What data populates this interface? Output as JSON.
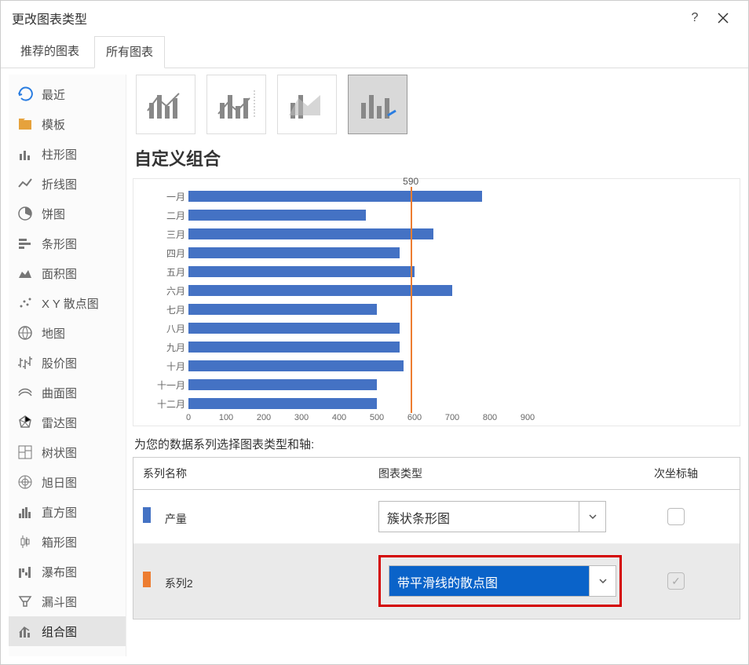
{
  "title": "更改图表类型",
  "tabs": {
    "recommended": "推荐的图表",
    "all": "所有图表"
  },
  "sidebar": {
    "items": [
      {
        "label": "最近",
        "icon": "recent"
      },
      {
        "label": "模板",
        "icon": "template"
      },
      {
        "label": "柱形图",
        "icon": "column"
      },
      {
        "label": "折线图",
        "icon": "line"
      },
      {
        "label": "饼图",
        "icon": "pie"
      },
      {
        "label": "条形图",
        "icon": "bar"
      },
      {
        "label": "面积图",
        "icon": "area"
      },
      {
        "label": "X Y 散点图",
        "icon": "scatter"
      },
      {
        "label": "地图",
        "icon": "map"
      },
      {
        "label": "股价图",
        "icon": "stock"
      },
      {
        "label": "曲面图",
        "icon": "surface"
      },
      {
        "label": "雷达图",
        "icon": "radar"
      },
      {
        "label": "树状图",
        "icon": "treemap"
      },
      {
        "label": "旭日图",
        "icon": "sunburst"
      },
      {
        "label": "直方图",
        "icon": "histogram"
      },
      {
        "label": "箱形图",
        "icon": "boxplot"
      },
      {
        "label": "瀑布图",
        "icon": "waterfall"
      },
      {
        "label": "漏斗图",
        "icon": "funnel"
      },
      {
        "label": "组合图",
        "icon": "combo"
      }
    ],
    "selected_index": 18
  },
  "thumbs": [
    "combo-1",
    "combo-2",
    "combo-3",
    "combo-4"
  ],
  "thumb_selected": 3,
  "section_title": "自定义组合",
  "series_caption": "为您的数据系列选择图表类型和轴:",
  "series_table": {
    "headers": {
      "name": "系列名称",
      "type": "图表类型",
      "secondary": "次坐标轴"
    },
    "rows": [
      {
        "swatch": "blue",
        "name": "产量",
        "type": "簇状条形图",
        "secondary": false,
        "selected": false,
        "secondary_enabled": true
      },
      {
        "swatch": "orange",
        "name": "系列2",
        "type": "带平滑线的散点图",
        "secondary": true,
        "selected": true,
        "secondary_enabled": false
      }
    ]
  },
  "chart_data": {
    "type": "bar",
    "categories": [
      "一月",
      "二月",
      "三月",
      "四月",
      "五月",
      "六月",
      "七月",
      "八月",
      "九月",
      "十月",
      "十一月",
      "十二月"
    ],
    "values": [
      780,
      470,
      650,
      560,
      600,
      700,
      500,
      560,
      560,
      570,
      500,
      500
    ],
    "x_ticks": [
      0,
      100,
      200,
      300,
      400,
      500,
      600,
      700,
      800,
      900
    ],
    "xlim": [
      0,
      900
    ],
    "reference_line": {
      "value": 590,
      "label": "590",
      "color": "#ED7D31"
    },
    "bar_color": "#4472C4"
  }
}
